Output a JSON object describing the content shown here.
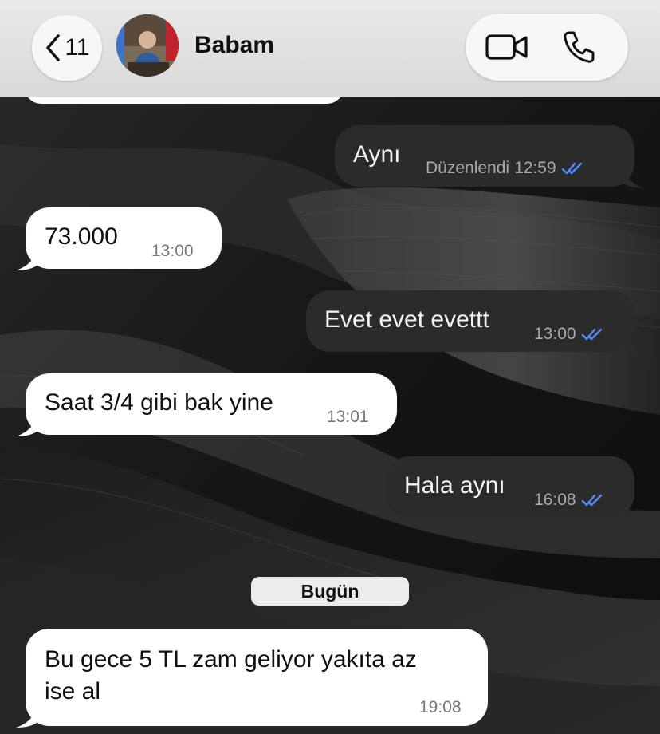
{
  "header": {
    "back_count": "11",
    "contact_name": "Babam"
  },
  "messages": [
    {
      "direction": "outgoing",
      "text": "Aynı",
      "edited_label": "Düzenlendi",
      "time": "12:59",
      "status": "read"
    },
    {
      "direction": "incoming",
      "text": "73.000",
      "time": "13:00"
    },
    {
      "direction": "outgoing",
      "text": "Evet evet evettt",
      "time": "13:00",
      "status": "read"
    },
    {
      "direction": "incoming",
      "text": "Saat 3/4 gibi bak yine",
      "time": "13:01"
    },
    {
      "direction": "outgoing",
      "text": "Hala aynı",
      "time": "16:08",
      "status": "read"
    },
    {
      "direction": "incoming",
      "text_line1": "Bu gece 5 TL zam geliyor yakıta az",
      "text_line2": "ise al",
      "time": "19:08"
    }
  ],
  "date_separator": "Bugün",
  "colors": {
    "incoming_bubble": "#ffffff",
    "outgoing_bubble": "#2b2b2b",
    "read_ticks": "#4f8cff",
    "header_bg": "#e4e4e4"
  },
  "icons": [
    "chevron-left-icon",
    "video-camera-icon",
    "phone-icon",
    "double-check-icon"
  ]
}
